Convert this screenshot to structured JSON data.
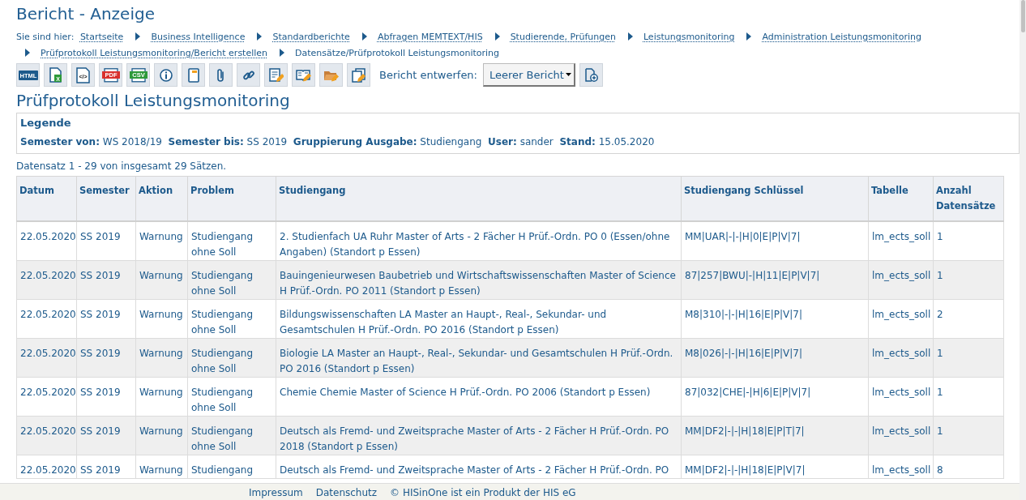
{
  "page_title": "Bericht - Anzeige",
  "breadcrumb": {
    "label": "Sie sind hier:",
    "items": [
      {
        "text": "Startseite",
        "link": true
      },
      {
        "text": "Business Intelligence",
        "link": true
      },
      {
        "text": "Standardberichte",
        "link": true
      },
      {
        "text": "Abfragen MEMTEXT/HIS",
        "link": true
      },
      {
        "text": "Studierende, Prüfungen",
        "link": true
      },
      {
        "text": "Leistungsmonitoring",
        "link": true
      },
      {
        "text": "Administration Leistungsmonitoring",
        "link": true
      },
      {
        "text": "Prüfprotokoll Leistungsmonitoring/Bericht erstellen",
        "link": true
      },
      {
        "text": "Datensätze/Prüfprotokoll Leistungsmonitoring",
        "link": false
      }
    ]
  },
  "toolbar": [
    {
      "kind": "html",
      "glyph": "HTML"
    },
    {
      "kind": "excel",
      "glyph": "X"
    },
    {
      "kind": "xml",
      "glyph": "</>"
    },
    {
      "kind": "pdf",
      "glyph": "PDF"
    },
    {
      "kind": "csv",
      "glyph": "CSV"
    },
    {
      "kind": "info"
    },
    {
      "kind": "notebook"
    },
    {
      "kind": "paperclip"
    },
    {
      "kind": "link"
    },
    {
      "kind": "edit-document"
    },
    {
      "kind": "edit-book"
    },
    {
      "kind": "edit-folder"
    },
    {
      "kind": "edit-copy"
    }
  ],
  "design": {
    "label": "Bericht entwerfen:",
    "select_value": "Leerer Bericht"
  },
  "report_title": "Prüfprotokoll Leistungsmonitoring",
  "legend": {
    "title": "Legende",
    "entries": [
      {
        "key": "Semester von:",
        "value": "WS 2018/19"
      },
      {
        "key": "Semester bis:",
        "value": "SS 2019"
      },
      {
        "key": "Gruppierung Ausgabe:",
        "value": "Studiengang"
      },
      {
        "key": "User:",
        "value": "sander"
      },
      {
        "key": "Stand:",
        "value": "15.05.2020"
      }
    ]
  },
  "record_info": "Datensatz 1 - 29 von insgesamt 29 Sätzen.",
  "table": {
    "columns": [
      "Datum",
      "Semester",
      "Aktion",
      "Problem",
      "Studiengang",
      "Studiengang Schlüssel",
      "Tabelle",
      "Anzahl Datensätze"
    ],
    "rows": [
      [
        "22.05.2020",
        "SS 2019",
        "Warnung",
        "Studiengang ohne Soll",
        "2. Studienfach UA Ruhr Master of Arts - 2 Fächer H Prüf.-Ordn. PO 0 (Essen/ohne Angaben) (Standort p Essen)",
        "MM|UAR|-|-|H|0|E|P|V|7|",
        "lm_ects_soll",
        "1"
      ],
      [
        "22.05.2020",
        "SS 2019",
        "Warnung",
        "Studiengang ohne Soll",
        "Bauingenieurwesen Baubetrieb und Wirtschaftswissenschaften Master of Science H Prüf.-Ordn. PO 2011 (Standort p Essen)",
        "87|257|BWU|-|H|11|E|P|V|7|",
        "lm_ects_soll",
        "1"
      ],
      [
        "22.05.2020",
        "SS 2019",
        "Warnung",
        "Studiengang ohne Soll",
        "Bildungswissenschaften LA Master an Haupt-, Real-, Sekundar- und Gesamtschulen H Prüf.-Ordn. PO 2016 (Standort p Essen)",
        "M8|310|-|-|H|16|E|P|V|7|",
        "lm_ects_soll",
        "2"
      ],
      [
        "22.05.2020",
        "SS 2019",
        "Warnung",
        "Studiengang ohne Soll",
        "Biologie LA Master an Haupt-, Real-, Sekundar- und Gesamtschulen H Prüf.-Ordn. PO 2016 (Standort p Essen)",
        "M8|026|-|-|H|16|E|P|V|7|",
        "lm_ects_soll",
        "1"
      ],
      [
        "22.05.2020",
        "SS 2019",
        "Warnung",
        "Studiengang ohne Soll",
        "Chemie Chemie Master of Science H Prüf.-Ordn. PO 2006 (Standort p Essen)",
        "87|032|CHE|-|H|6|E|P|V|7|",
        "lm_ects_soll",
        "1"
      ],
      [
        "22.05.2020",
        "SS 2019",
        "Warnung",
        "Studiengang ohne Soll",
        "Deutsch als Fremd- und Zweitsprache Master of Arts - 2 Fächer H Prüf.-Ordn. PO 2018 (Standort p Essen)",
        "MM|DF2|-|-|H|18|E|P|T|7|",
        "lm_ects_soll",
        "1"
      ],
      [
        "22.05.2020",
        "SS 2019",
        "Warnung",
        "Studiengang",
        "Deutsch als Fremd- und Zweitsprache Master of Arts - 2 Fächer H Prüf.-Ordn. PO",
        "MM|DF2|-|-|H|18|E|P|V|7|",
        "lm_ects_soll",
        "8"
      ]
    ]
  },
  "footer": {
    "links": [
      "Impressum",
      "Datenschutz"
    ],
    "text": "© HISinOne ist ein Produkt der HIS eG"
  }
}
